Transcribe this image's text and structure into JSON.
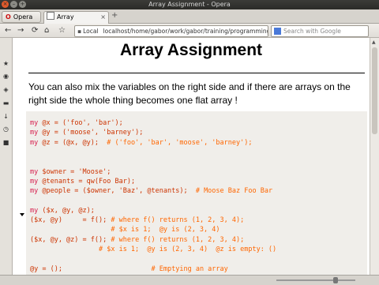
{
  "window": {
    "title": "Array Assignment - Opera"
  },
  "tabbar": {
    "opera_label": "Opera",
    "tab_title": "Array Assignment",
    "new_tab": "+"
  },
  "navbar": {
    "back": "←",
    "forward": "→",
    "reload": "⟳",
    "home": "⌂",
    "speed_dial": "☆",
    "url_scheme": "Local",
    "url_path": "localhost/home/gabor/work/gabor/training/programming_pe",
    "search_placeholder": "Search with Google"
  },
  "sidebar": {
    "icons": [
      "bookmarks-icon",
      "windows-icon",
      "share-icon",
      "notes-icon",
      "downloads-icon",
      "history-icon",
      "extensions-icon"
    ]
  },
  "page": {
    "heading": "Array Assignment",
    "paragraph": "You can also mix the variables on the right side and if there are arrays on the right side the whole thing becomes one flat array !"
  },
  "code": {
    "lines": [
      [
        [
          "kw",
          "my "
        ],
        [
          "tx",
          "@x = ("
        ],
        [
          "tx",
          "'foo'"
        ],
        [
          "tx",
          ", "
        ],
        [
          "tx",
          "'bar'"
        ],
        [
          "tx",
          ");"
        ]
      ],
      [
        [
          "kw",
          "my "
        ],
        [
          "tx",
          "@y = ("
        ],
        [
          "tx",
          "'moose'"
        ],
        [
          "tx",
          ", "
        ],
        [
          "tx",
          "'barney'"
        ],
        [
          "tx",
          ");"
        ]
      ],
      [
        [
          "kw",
          "my "
        ],
        [
          "tx",
          "@z = (@x, @y);  "
        ],
        [
          "cm",
          "# ('foo', 'bar', 'moose', 'barney');"
        ]
      ],
      [],
      [],
      [
        [
          "kw",
          "my "
        ],
        [
          "tx",
          "$owner = 'Moose';"
        ]
      ],
      [
        [
          "kw",
          "my "
        ],
        [
          "tx",
          "@tenants = qw(Foo Bar);"
        ]
      ],
      [
        [
          "kw",
          "my "
        ],
        [
          "tx",
          "@people = ($owner, 'Baz', @tenants);  "
        ],
        [
          "cm",
          "# Moose Baz Foo Bar"
        ]
      ],
      [],
      [
        [
          "kw",
          "my "
        ],
        [
          "tx",
          "($x, @y, @z);"
        ]
      ],
      [
        [
          "tx",
          "($x, @y)     = f(); "
        ],
        [
          "cm",
          "# where f() returns (1, 2, 3, 4);"
        ]
      ],
      [
        [
          "cm",
          "                    # $x is 1;  @y is (2, 3, 4)"
        ]
      ],
      [
        [
          "tx",
          "($x, @y, @z) = f(); "
        ],
        [
          "cm",
          "# where f() returns (1, 2, 3, 4);"
        ]
      ],
      [
        [
          "cm",
          "                 # $x is 1;  @y is (2, 3, 4)  @z is empty: ()"
        ]
      ],
      [],
      [
        [
          "tx",
          "@y = ();                      "
        ],
        [
          "cm",
          "# Emptying an array"
        ]
      ]
    ]
  }
}
